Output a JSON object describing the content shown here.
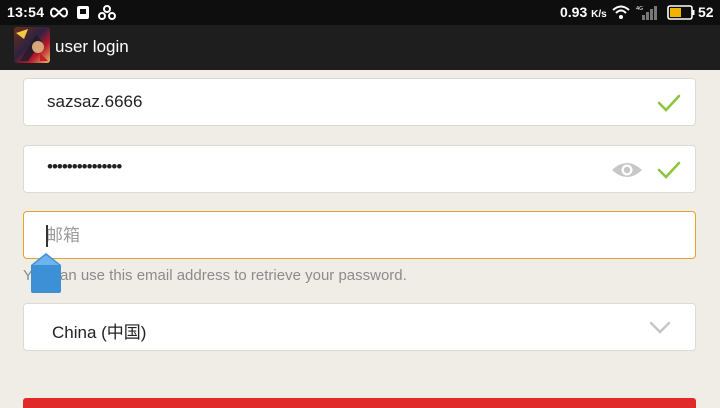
{
  "statusbar": {
    "time": "13:54",
    "net_speed_value": "0.93",
    "net_speed_unit": "K/s",
    "battery": "52"
  },
  "appbar": {
    "title": "user login"
  },
  "form": {
    "username": "sazsaz.6666",
    "password_mask": "•••••••••••••••",
    "email_placeholder": "邮箱",
    "email_value": "",
    "hint": "You can use this email address to retrieve your password.",
    "country": "China (中国)"
  },
  "colors": {
    "accent_check": "#8cc63f",
    "email_focus_border": "#e7a22c",
    "submit": "#e02a2a"
  }
}
